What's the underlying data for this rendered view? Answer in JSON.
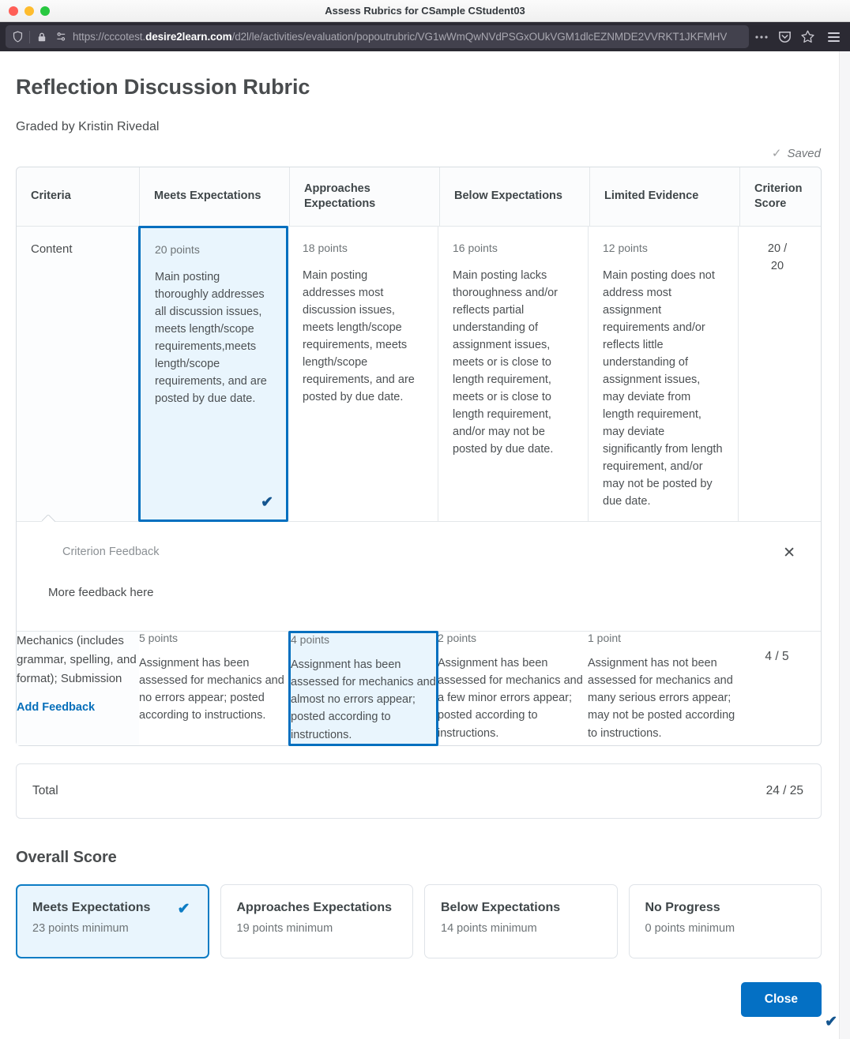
{
  "window": {
    "title": "Assess Rubrics for CSample CStudent03"
  },
  "browser": {
    "url_scheme": "https://cccotest.",
    "url_host": "desire2learn.com",
    "url_path": "/d2l/le/activities/evaluation/popoutrubric/VG1wWmQwNVdPSGxOUkVGM1dlcEZNMDE2VVRKT1JKFMHV",
    "icons": {
      "shield": "shield-icon",
      "lock": "lock-icon",
      "permissions": "permissions-icon",
      "more": "ellipsis-icon",
      "pocket": "pocket-icon",
      "bookmark": "star-icon",
      "menu": "hamburger-icon"
    }
  },
  "header": {
    "title": "Reflection Discussion Rubric",
    "graded_by": "Graded by Kristin Rivedal",
    "saved_label": "Saved",
    "saved_check": "✓"
  },
  "table": {
    "columns": [
      "Criteria",
      "Meets Expectations",
      "Approaches Expectations",
      "Below Expectations",
      "Limited Evidence",
      "Criterion Score"
    ],
    "rows": [
      {
        "criterion": "Content",
        "score": "20 / 20",
        "score_line1": "20 /",
        "score_line2": "20",
        "cells": [
          {
            "points": "20 points",
            "desc": "Main posting thoroughly addresses all discussion issues, meets length/scope requirements,meets length/scope requirements, and are posted by due date.",
            "selected": true
          },
          {
            "points": "18 points",
            "desc": "Main posting addresses most discussion issues, meets length/scope requirements, meets length/scope requirements, and are posted by due date.",
            "selected": false
          },
          {
            "points": "16 points",
            "desc": "Main posting lacks thoroughness and/or reflects partial understanding of assignment issues, meets or is close to length requirement, meets or is close to length requirement, and/or may not be posted by due date.",
            "selected": false
          },
          {
            "points": "12 points",
            "desc": "Main posting does not address most assignment requirements and/or reflects little understanding of assignment issues, may deviate from length requirement, may deviate significantly from length requirement, and/or may not be posted by due date.",
            "selected": false
          }
        ]
      },
      {
        "criterion": "Mechanics (includes grammar, spelling, and format); Submission",
        "add_feedback_label": "Add Feedback",
        "score": "4 / 5",
        "cells": [
          {
            "points": "5 points",
            "desc": "Assignment has been assessed for mechanics and no errors appear; posted according to instructions.",
            "selected": false
          },
          {
            "points": "4 points",
            "desc": "Assignment has been assessed for mechanics and almost no errors appear; posted according to instructions.",
            "selected": true
          },
          {
            "points": "2 points",
            "desc": "Assignment has been assessed for mechanics and a few minor errors appear; posted according to instructions.",
            "selected": false
          },
          {
            "points": "1 point",
            "desc": "Assignment has not been assessed for mechanics and many serious errors appear; may not be posted according to instructions.",
            "selected": false
          }
        ]
      }
    ],
    "selected_check": "✔"
  },
  "feedback_panel": {
    "label": "Criterion Feedback",
    "text": "More feedback here",
    "close_glyph": "✕"
  },
  "total": {
    "label": "Total",
    "value": "24 / 25"
  },
  "overall": {
    "title": "Overall Score",
    "check_glyph": "✔",
    "cards": [
      {
        "title": "Meets Expectations",
        "sub": "23 points minimum",
        "selected": true
      },
      {
        "title": "Approaches Expectations",
        "sub": "19 points minimum",
        "selected": false
      },
      {
        "title": "Below Expectations",
        "sub": "14 points minimum",
        "selected": false
      },
      {
        "title": "No Progress",
        "sub": "0 points minimum",
        "selected": false
      }
    ]
  },
  "footer": {
    "close_label": "Close"
  },
  "colors": {
    "accent_blue": "#0470c4",
    "selected_border": "#006fbf",
    "selected_bg": "#e9f5fd",
    "link_blue": "#066fba",
    "text": "#494c4e"
  }
}
